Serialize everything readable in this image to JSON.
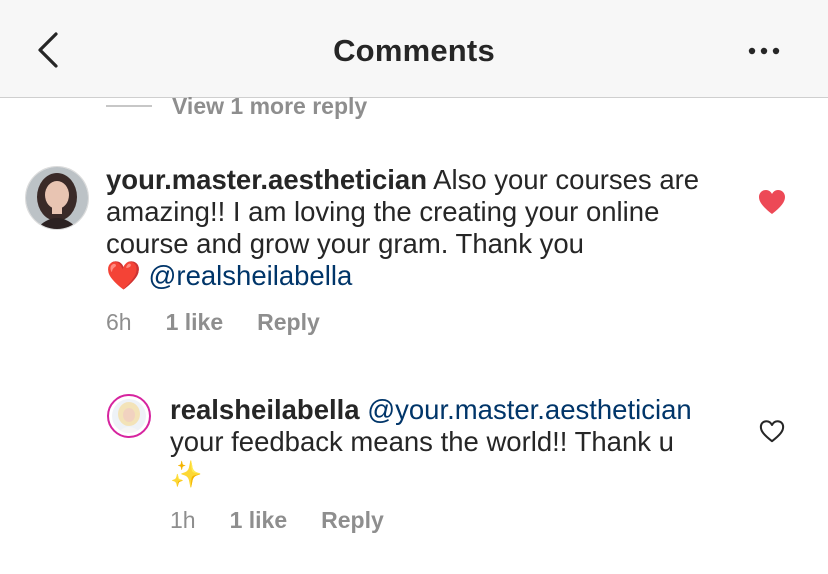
{
  "header": {
    "title": "Comments",
    "back_icon": "chevron-left-icon",
    "more_icon": "more-horizontal-icon"
  },
  "view_more": {
    "label": "View 1 more reply"
  },
  "comments": [
    {
      "username": "your.master.aesthetician",
      "text_1": " Also your courses are amazing!! I am loving the creating your online course and grow your gram. Thank you",
      "emoji": "❤️",
      "mention": "@realsheilabella",
      "time": "6h",
      "likes": "1 like",
      "reply": "Reply",
      "liked": true,
      "like_color": "#ed4956"
    },
    {
      "username": "realsheilabella",
      "mention": "@your.master.aesthetician",
      "text_1": "your feedback means the world!! Thank u",
      "emoji": "✨",
      "time": "1h",
      "likes": "1 like",
      "reply": "Reply",
      "liked": false
    }
  ],
  "colors": {
    "header_bg": "#f7f7f7",
    "secondary_text": "#8e8e8e",
    "mention": "#003569",
    "story_ring": "#d6249f"
  }
}
